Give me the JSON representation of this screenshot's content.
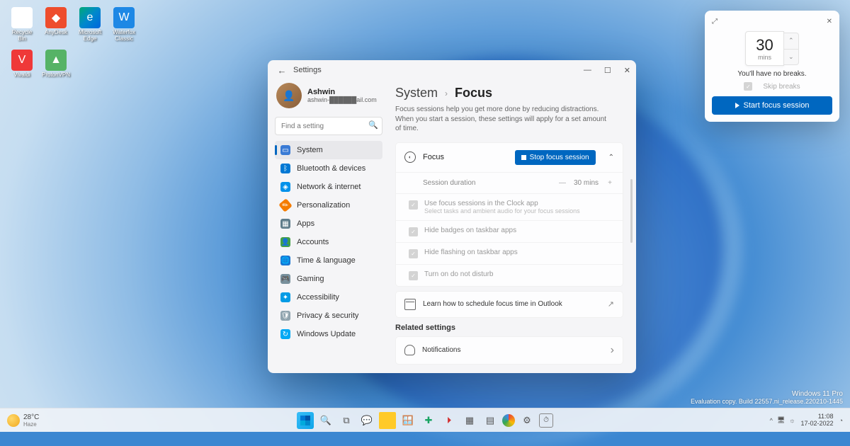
{
  "desktop": {
    "icons": [
      {
        "label": "Recycle Bin"
      },
      {
        "label": "AnyDesk"
      },
      {
        "label": "Microsoft Edge"
      },
      {
        "label": "Waterfox Classic"
      },
      {
        "label": "Vivaldi"
      },
      {
        "label": "ProtonVPN"
      }
    ]
  },
  "settings": {
    "title": "Settings",
    "account": {
      "name": "Ashwin",
      "email": "ashwin-██████ail.com"
    },
    "search_placeholder": "Find a setting",
    "nav": [
      {
        "label": "System"
      },
      {
        "label": "Bluetooth & devices"
      },
      {
        "label": "Network & internet"
      },
      {
        "label": "Personalization"
      },
      {
        "label": "Apps"
      },
      {
        "label": "Accounts"
      },
      {
        "label": "Time & language"
      },
      {
        "label": "Gaming"
      },
      {
        "label": "Accessibility"
      },
      {
        "label": "Privacy & security"
      },
      {
        "label": "Windows Update"
      }
    ],
    "breadcrumb": {
      "parent": "System",
      "current": "Focus"
    },
    "description": "Focus sessions help you get more done by reducing distractions. When you start a session, these settings will apply for a set amount of time.",
    "focus": {
      "title": "Focus",
      "stop_label": "Stop focus session",
      "session_duration_label": "Session duration",
      "session_duration_value": "30 mins",
      "opt1": {
        "title": "Use focus sessions in the Clock app",
        "sub": "Select tasks and ambient audio for your focus sessions"
      },
      "opt2": "Hide badges on taskbar apps",
      "opt3": "Hide flashing on taskbar apps",
      "opt4": "Turn on do not disturb",
      "outlook": "Learn how to schedule focus time in Outlook"
    },
    "related_heading": "Related settings",
    "notifications": "Notifications"
  },
  "focus_popup": {
    "duration": "30",
    "unit": "mins",
    "breaks_msg": "You'll have no breaks.",
    "skip_label": "Skip breaks",
    "start_label": "Start focus session"
  },
  "watermark": {
    "line1": "Windows 11 Pro",
    "line2": "Evaluation copy. Build 22557.ni_release.220210-1445"
  },
  "taskbar": {
    "temp": "28°C",
    "cond": "Haze",
    "time": "11:08",
    "date": "17-02-2022"
  }
}
